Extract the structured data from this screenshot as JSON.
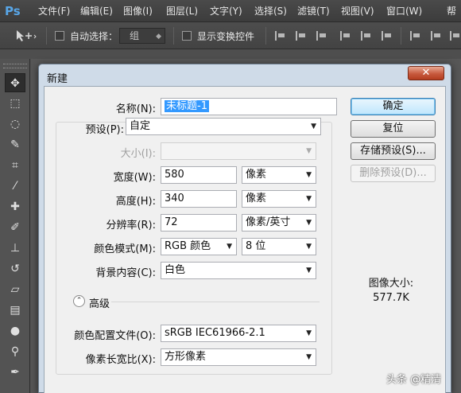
{
  "app": {
    "logo": "Ps"
  },
  "menu": [
    "文件(F)",
    "编辑(E)",
    "图像(I)",
    "图层(L)",
    "文字(Y)",
    "选择(S)",
    "滤镜(T)",
    "视图(V)",
    "窗口(W)",
    "帮"
  ],
  "options_bar": {
    "auto_select_label": "自动选择：",
    "auto_select_value": "组",
    "show_transform_label": "显示变换控件"
  },
  "dialog": {
    "title": "新建",
    "close_glyph": "✕",
    "name_label": "名称(N):",
    "name_value": "未标题-1",
    "preset_label": "预设(P):",
    "preset_value": "自定",
    "size_label": "大小(I):",
    "size_value": "",
    "width_label": "宽度(W):",
    "width_value": "580",
    "width_unit": "像素",
    "height_label": "高度(H):",
    "height_value": "340",
    "height_unit": "像素",
    "resolution_label": "分辨率(R):",
    "resolution_value": "72",
    "resolution_unit": "像素/英寸",
    "color_mode_label": "颜色模式(M):",
    "color_mode_value": "RGB 颜色",
    "bit_depth_value": "8 位",
    "background_label": "背景内容(C):",
    "background_value": "白色",
    "advanced_label": "高级",
    "color_profile_label": "颜色配置文件(O):",
    "color_profile_value": "sRGB IEC61966-2.1",
    "pixel_aspect_label": "像素长宽比(X):",
    "pixel_aspect_value": "方形像素",
    "buttons": {
      "ok": "确定",
      "reset": "复位",
      "save_preset": "存储预设(S)...",
      "delete_preset": "删除预设(D)..."
    },
    "image_size_label": "图像大小:",
    "image_size_value": "577.7K"
  },
  "watermark": "头条 @精清",
  "colors": {
    "accent_selection": "#3399ff",
    "default_button": "#bee6fd",
    "dialog_frame": "#cfdbe8",
    "close_button": "#c75a3e"
  }
}
